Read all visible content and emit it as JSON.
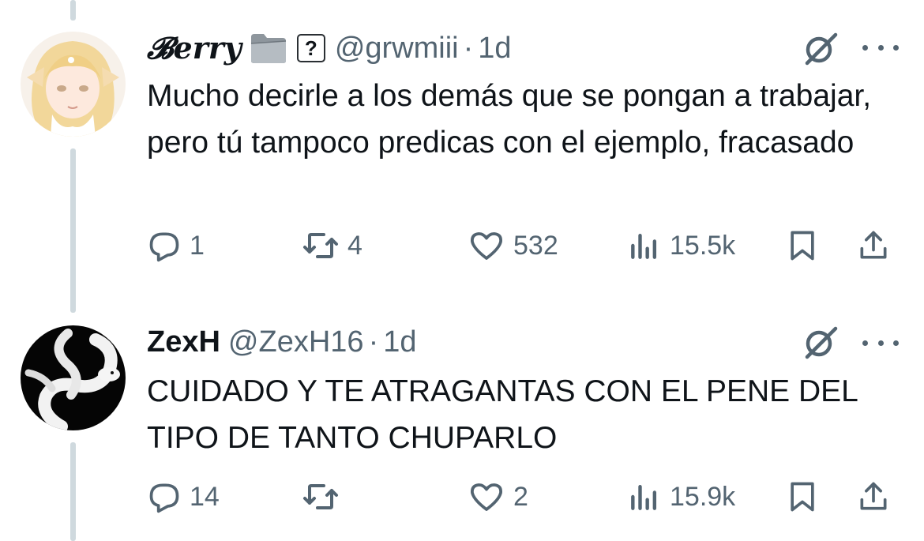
{
  "tweets": [
    {
      "display_name": "𝓑erry",
      "badges": [
        "folder-icon",
        "question-box-icon"
      ],
      "question_badge": "?",
      "handle": "@grwmiii",
      "separator": "·",
      "time": "1d",
      "text": "Mucho decirle a los demás que se pongan a trabajar, pero tú tampoco predicas con el ejemplo, fracasado",
      "replies": "1",
      "retweets": "4",
      "likes": "532",
      "views": "15.5k"
    },
    {
      "display_name": "ZexH",
      "handle": "@ZexH16",
      "separator": "·",
      "time": "1d",
      "text": "CUIDADO Y TE ATRAGANTAS CON EL PENE DEL TIPO DE TANTO CHUPARLO",
      "replies": "14",
      "retweets": "",
      "likes": "2",
      "views": "15.9k"
    }
  ],
  "colors": {
    "text": "#0f1419",
    "secondary": "#536471",
    "thread_line": "#cfd9de"
  }
}
